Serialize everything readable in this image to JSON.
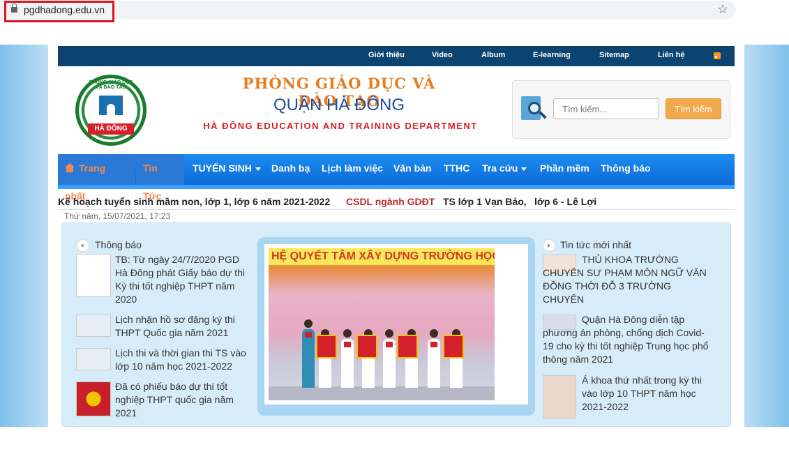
{
  "browser": {
    "url": "pgdhadong.edu.vn"
  },
  "top_nav": [
    "Giới thiệu",
    "Video",
    "Album",
    "E-learning",
    "Sitemap",
    "Liên hệ"
  ],
  "header": {
    "logo_arc": "PHÒNG GIÁO DỤC VÀ ĐÀO TẠO",
    "logo_ribbon": "HÀ ĐÔNG",
    "title_line1": "PHÒNG GIÁO DỤC VÀ ĐÀO TẠO",
    "title_line2": "QUẬN HÀ ĐÔNG",
    "title_line3": "HÀ ĐÔNG EDUCATION AND TRAINING DEPARTMENT"
  },
  "search": {
    "placeholder": "Tìm kiếm...",
    "button": "Tìm kiếm"
  },
  "main_nav": {
    "home": "Trang nhất",
    "items": [
      "Tin Tức",
      "TUYỂN SINH",
      "Danh bạ",
      "Lịch làm việc",
      "Văn bản",
      "TTHC",
      "Tra cứu",
      "Phần mềm",
      "Thông báo"
    ]
  },
  "ticker": {
    "item1": "Kế hoạch tuyển sinh mầm non, lớp 1, lớp 6 năm 2021-2022",
    "item2": "CSDL ngành GDĐT",
    "item3": "TS lớp 1 Vạn Bảo,",
    "item4": "lớp 6 - Lê Lợi"
  },
  "datetime": "Thứ năm, 15/07/2021, 17:23",
  "left_column": {
    "heading": "Thông báo",
    "items": [
      {
        "text": "TB: Từ ngày 24/7/2020 PGD Hà Đông phát Giấy báo dự thi Kỳ thi tốt nghiệp THPT năm 2020"
      },
      {
        "text": "Lịch nhận hồ sơ đăng ký thi THPT Quốc gia năm 2021"
      },
      {
        "text": "Lịch thi và thời gian thi TS vào lớp 10 năm học 2021-2022"
      },
      {
        "text": "Đã có phiếu báo dự thi tốt nghiệp THPT quốc gia năm 2021"
      }
    ]
  },
  "featured": {
    "banner": "HỆ QUYẾT TÂM XÂY DỰNG TRƯỜNG HỌC THÂN THIỆN"
  },
  "right_column": {
    "heading": "Tin tức mới nhất",
    "items": [
      {
        "text": "THỦ KHOA TRƯỜNG CHUYÊN SƯ PHẠM MÔN NGỮ VĂN ĐỒNG THỜI ĐỖ 3 TRƯỜNG CHUYÊN"
      },
      {
        "text": "Quận Hà Đông diễn tập phương án phòng, chống dịch Covid-19 cho kỳ thi tốt nghiệp Trung học phổ thông năm 2021"
      },
      {
        "text": "Á khoa thứ nhất trong kỳ thi vào lớp 10 THPT năm học 2021-2022"
      }
    ]
  }
}
